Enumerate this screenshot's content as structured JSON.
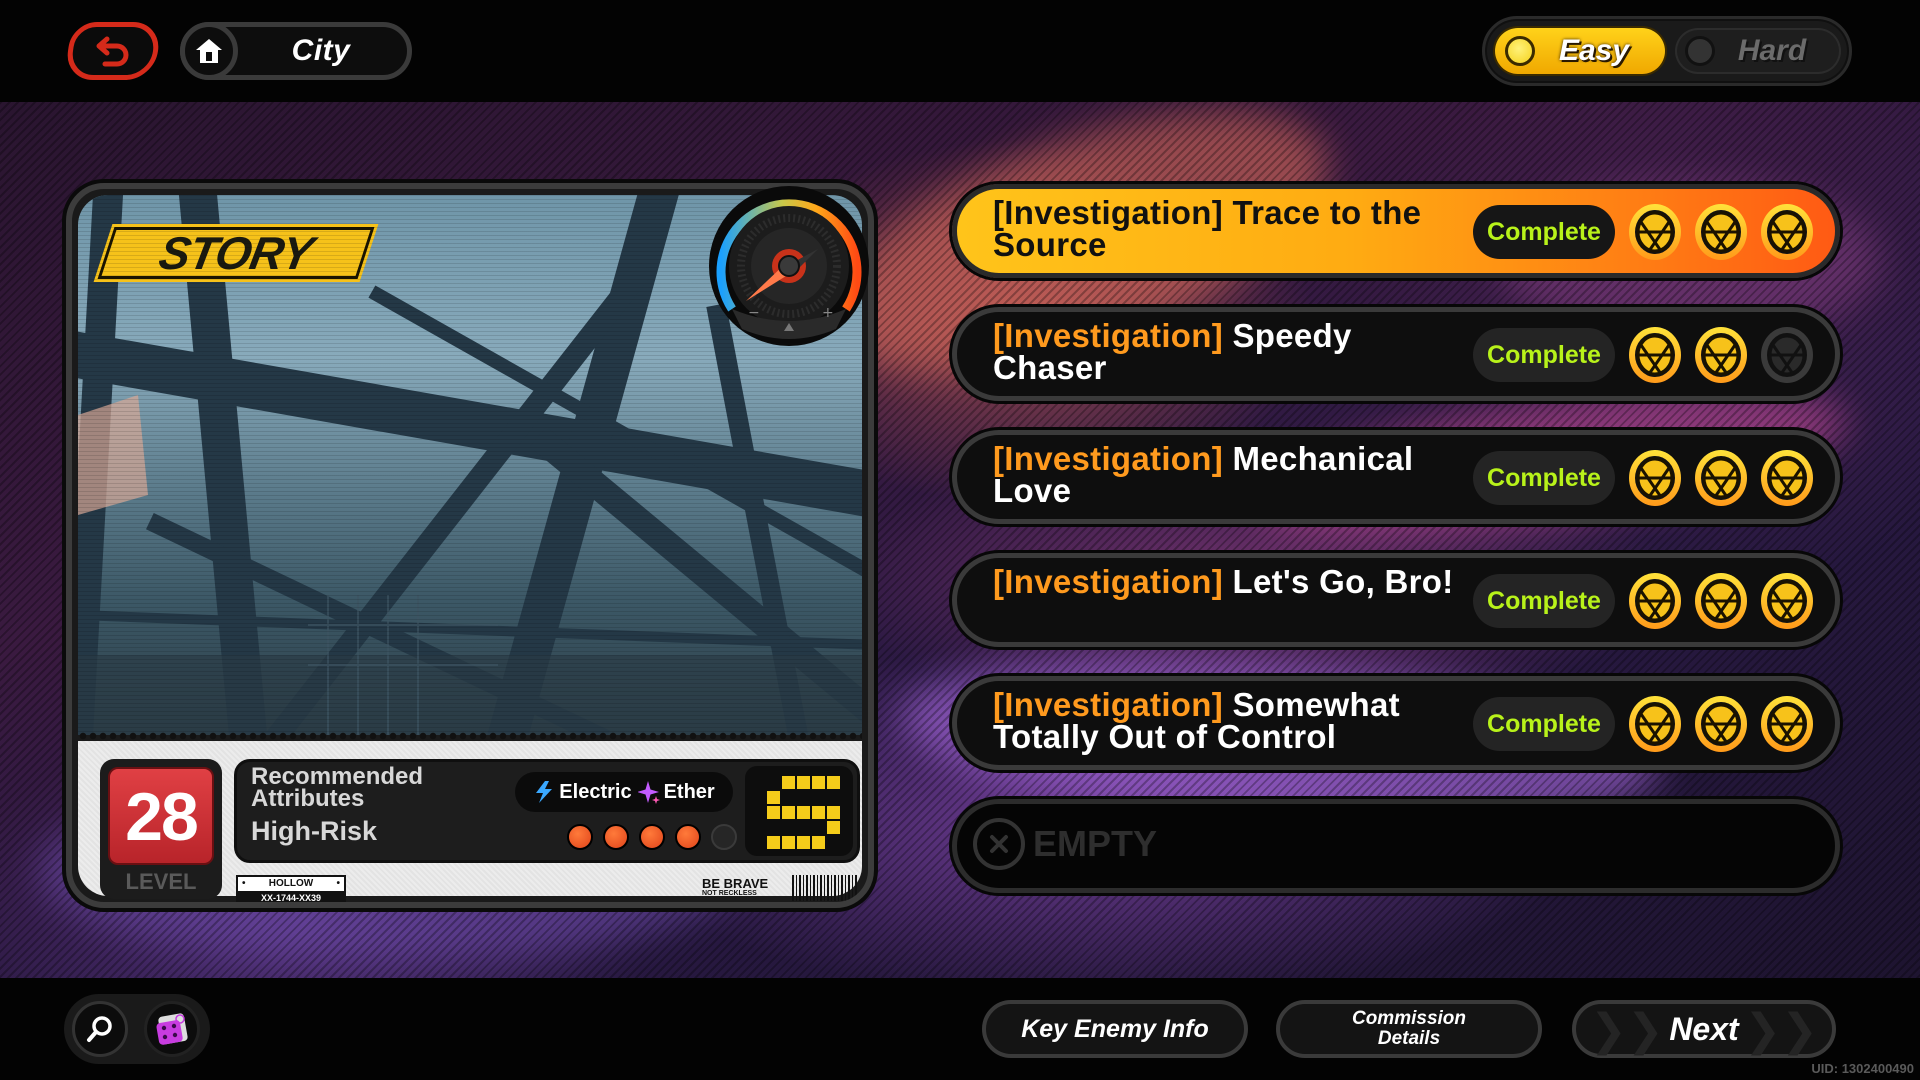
{
  "nav": {
    "back_icon": "back-arrow-icon",
    "location_icon": "home-icon",
    "location": "City"
  },
  "difficulty": {
    "options": [
      {
        "label": "Easy",
        "selected": true
      },
      {
        "label": "Hard",
        "selected": false
      }
    ],
    "accent": "#F5C518"
  },
  "card": {
    "type_tag": "STORY",
    "level_value": "28",
    "level_label": "LEVEL",
    "recommended_label": "Recommended Attributes",
    "attributes": [
      {
        "name": "Electric",
        "icon": "electric-bolt-icon",
        "color": "#3aa8ff"
      },
      {
        "name": "Ether",
        "icon": "ether-sparkle-icon",
        "color": "#c35cff"
      }
    ],
    "risk_label": "High-Risk",
    "risk_level": 4,
    "risk_max": 5,
    "rank": "S",
    "plate_title": "HOLLOW",
    "plate_code": "XX-1744-XX39",
    "slogan_1": "BE BRAVE",
    "slogan_2": "NOT RECKLESS",
    "gauge_icon": "speedometer-gauge-icon"
  },
  "commissions": [
    {
      "tag": "[Investigation]",
      "name": "Trace to the Source",
      "status": "Complete",
      "medals_earned": 3,
      "medals_total": 3,
      "selected": true
    },
    {
      "tag": "[Investigation]",
      "name": "Speedy Chaser",
      "status": "Complete",
      "medals_earned": 2,
      "medals_total": 3,
      "selected": false
    },
    {
      "tag": "[Investigation]",
      "name": "Mechanical Love",
      "status": "Complete",
      "medals_earned": 3,
      "medals_total": 3,
      "selected": false
    },
    {
      "tag": "[Investigation]",
      "name": "Let's Go, Bro!",
      "status": "Complete",
      "medals_earned": 3,
      "medals_total": 3,
      "selected": false
    },
    {
      "tag": "[Investigation]",
      "name": "Somewhat Totally Out of Control",
      "status": "Complete",
      "medals_earned": 3,
      "medals_total": 3,
      "selected": false
    }
  ],
  "empty_slot": {
    "label": "EMPTY",
    "icon": "close-x-icon"
  },
  "bottom": {
    "search_icon": "search-icon",
    "dice_icon": "dice-icon",
    "key_enemy_label": "Key Enemy Info",
    "commission_details_label": "Commission Details",
    "next_label": "Next",
    "uid": "UID: 1302400490"
  },
  "colors": {
    "complete_text": "#B8F21A",
    "investigation_tag": "#FF9A1E",
    "selected_row_start": "#FFC41A",
    "selected_row_end": "#FF5A14",
    "back_button": "#D52A1A"
  }
}
